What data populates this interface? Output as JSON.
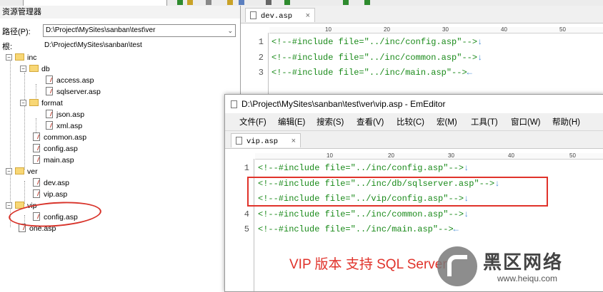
{
  "explorer": {
    "title": "资源管理器",
    "path_label": "路径(P):",
    "path_value": "D:\\Project\\MySites\\sanban\\test\\ver",
    "root_label": "根:",
    "root_value": "D:\\Project\\MySites\\sanban\\test",
    "tree": [
      {
        "label": "inc"
      },
      {
        "label": "db"
      },
      {
        "label": "access.asp"
      },
      {
        "label": "sqlserver.asp"
      },
      {
        "label": "format"
      },
      {
        "label": "json.asp"
      },
      {
        "label": "xml.asp"
      },
      {
        "label": "common.asp"
      },
      {
        "label": "config.asp"
      },
      {
        "label": "main.asp"
      },
      {
        "label": "ver"
      },
      {
        "label": "dev.asp"
      },
      {
        "label": "vip.asp"
      },
      {
        "label": "vip"
      },
      {
        "label": "config.asp"
      },
      {
        "label": "one.asp"
      }
    ]
  },
  "editor_back": {
    "tab_label": "dev.asp",
    "ruler": [
      "10",
      "20",
      "30",
      "40",
      "50"
    ],
    "lines": [
      {
        "num": "1",
        "code": "<!--#include file=\"../inc/config.asp\"-->",
        "eol": "↓"
      },
      {
        "num": "2",
        "code": "<!--#include file=\"../inc/common.asp\"-->",
        "eol": "↓"
      },
      {
        "num": "3",
        "code": "<!--#include file=\"../inc/main.asp\"-->",
        "eol": "←"
      }
    ]
  },
  "editor_front": {
    "window_title": "D:\\Project\\MySites\\sanban\\test\\ver\\vip.asp - EmEditor",
    "menu": [
      "文件(F)",
      "编辑(E)",
      "搜索(S)",
      "查看(V)",
      "比较(C)",
      "宏(M)",
      "工具(T)",
      "窗口(W)",
      "帮助(H)"
    ],
    "tab_label": "vip.asp",
    "ruler": [
      "10",
      "20",
      "30",
      "40",
      "50"
    ],
    "lines": [
      {
        "num": "1",
        "code": "<!--#include file=\"../inc/config.asp\"-->",
        "eol": "↓"
      },
      {
        "num": "",
        "code": "<!--#include file=\"../inc/db/sqlserver.asp\"-->",
        "eol": "↓"
      },
      {
        "num": "",
        "code": "<!--#include file=\"../vip/config.asp\"-->",
        "eol": "↓"
      },
      {
        "num": "4",
        "code": "<!--#include file=\"../inc/common.asp\"-->",
        "eol": "↓"
      },
      {
        "num": "5",
        "code": "<!--#include file=\"../inc/main.asp\"-->",
        "eol": "←"
      }
    ]
  },
  "annotation": {
    "caption": "VIP 版本 支持 SQL Server",
    "color": "#e0322a"
  },
  "watermark": {
    "title": "黑区网络",
    "url": "www.heiqu.com"
  },
  "colors": {
    "code_green": "#1a8a1a",
    "eol_blue": "#4d8fd6",
    "folder": "#f8d775"
  }
}
